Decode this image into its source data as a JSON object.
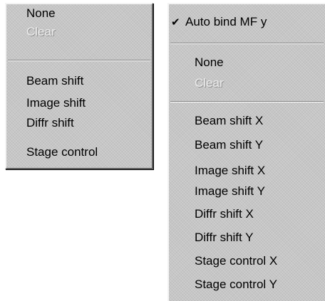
{
  "menus": {
    "left": {
      "items": [
        {
          "label": "None",
          "disabled": false
        },
        {
          "label": "Clear",
          "disabled": true
        },
        {
          "label": "Beam shift",
          "disabled": false
        },
        {
          "label": "Image shift",
          "disabled": false
        },
        {
          "label": "Diffr shift",
          "disabled": false
        },
        {
          "label": "Stage control",
          "disabled": false
        }
      ]
    },
    "right": {
      "check_item": {
        "label": "Auto bind MF y",
        "checked": true,
        "icon": "checkmark-icon",
        "glyph": "✔"
      },
      "items": [
        {
          "label": "None",
          "disabled": false
        },
        {
          "label": "Clear",
          "disabled": true
        },
        {
          "label": "Beam shift X",
          "disabled": false
        },
        {
          "label": "Beam shift Y",
          "disabled": false
        },
        {
          "label": "Image shift X",
          "disabled": false
        },
        {
          "label": "Image shift Y",
          "disabled": false
        },
        {
          "label": "Diffr shift X",
          "disabled": false
        },
        {
          "label": "Diffr shift Y",
          "disabled": false
        },
        {
          "label": "Stage control X",
          "disabled": false
        },
        {
          "label": "Stage control Y",
          "disabled": false
        }
      ]
    }
  },
  "colors": {
    "menu_face": "#c6c6c6",
    "disabled_text": "#ececec",
    "separator_dark": "#808080"
  }
}
